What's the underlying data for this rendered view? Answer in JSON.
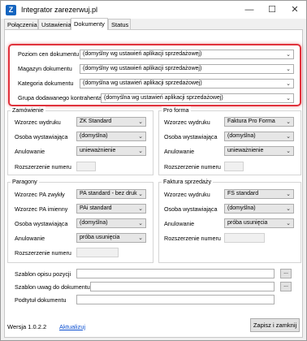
{
  "window": {
    "title": "Integrator zarezerwuj.pl",
    "icon_letter": "Z",
    "minimize": "—",
    "maximize": "☐",
    "close": "✕"
  },
  "tabs": [
    "Połączenia",
    "Ustawienia",
    "Dokumenty",
    "Status"
  ],
  "highlighted": {
    "rows": [
      {
        "label": "Poziom cen dokumentu",
        "value": "(domyślny wg ustawień aplikacji sprzedażowej)"
      },
      {
        "label": "Magazyn dokumentu",
        "value": "(domyślny wg ustawień aplikacji sprzedażowej)"
      },
      {
        "label": "Kategoria dokumentu",
        "value": "(domyślna wg ustawień aplikacji sprzedażowej)"
      },
      {
        "label": "Grupa dodawanego kontrahenta",
        "value": "(domyślna wg ustawień aplikacji sprzedażowej)"
      }
    ]
  },
  "zamowienie": {
    "title": "Zamówienie",
    "wzorzec_label": "Wzorzec wydruku",
    "wzorzec_value": "ZK Standard",
    "osoba_label": "Osoba wystawiająca",
    "osoba_value": "(domyślna)",
    "anulowanie_label": "Anulowanie",
    "anulowanie_value": "unieważnienie",
    "rozszerzenie_label": "Rozszerzenie numeru"
  },
  "proforma": {
    "title": "Pro forma",
    "wzorzec_label": "Wzorzec wydruku",
    "wzorzec_value": "Faktura Pro Forma",
    "osoba_label": "Osoba wystawiająca",
    "osoba_value": "(domyślna)",
    "anulowanie_label": "Anulowanie",
    "anulowanie_value": "unieważnienie",
    "rozszerzenie_label": "Rozszerzenie numeru"
  },
  "paragony": {
    "title": "Paragony",
    "pa_zwykly_label": "Wzorzec PA zwykły",
    "pa_zwykly_value": "PA standard - bez druk",
    "pa_imienny_label": "Wzorzec PA imienny",
    "pa_imienny_value": "PAi standard",
    "osoba_label": "Osoba wystawiająca",
    "osoba_value": "(domyślna)",
    "anulowanie_label": "Anulowanie",
    "anulowanie_value": "próba usunięcia",
    "rozszerzenie_label": "Rozszerzenie numeru"
  },
  "faktura": {
    "title": "Faktura sprzedaży",
    "wzorzec_label": "Wzorzec wydruku",
    "wzorzec_value": "FS standard",
    "osoba_label": "Osoba wystawiająca",
    "osoba_value": "(domyślna)",
    "anulowanie_label": "Anulowanie",
    "anulowanie_value": "próba usunięcia",
    "rozszerzenie_label": "Rozszerzenie numeru"
  },
  "bottom": {
    "szablon_pozycji_label": "Szablon opisu pozycji",
    "szablon_uwag_label": "Szablon uwag do dokumentu",
    "podtytul_label": "Podtytuł dokumentu",
    "browse_label": "..."
  },
  "footer": {
    "version": "Wersja 1.0.2.2",
    "update_link": "Aktualizuj",
    "save_button": "Zapisz i zamknij"
  },
  "colors": {
    "highlight_border": "#e0323c",
    "accent": "#1565c0",
    "link": "#0b4fd1"
  }
}
